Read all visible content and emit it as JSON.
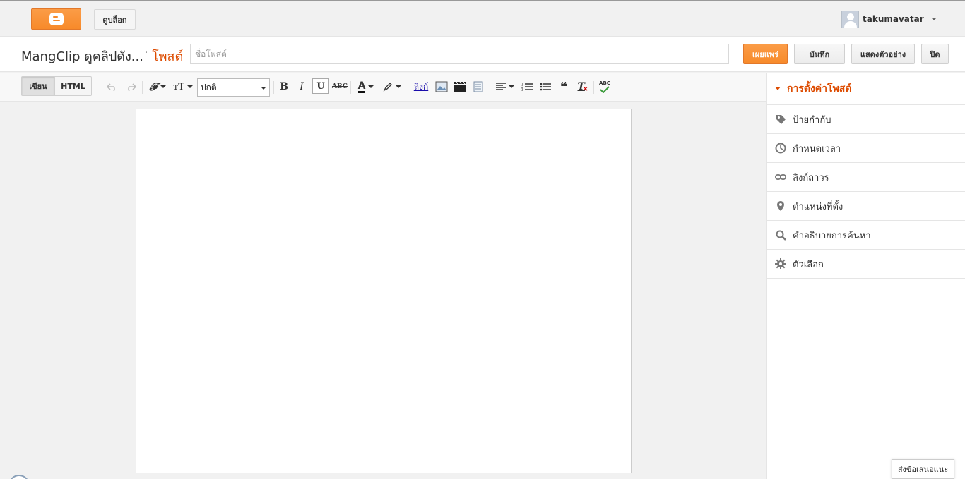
{
  "topbar": {
    "logo": "blogger-logo",
    "view_blog_label": "ดูบล็อก",
    "username": "takumavatar"
  },
  "titlebar": {
    "blog_name": "MangClip ดูคลิปดัง...",
    "separator": "·",
    "post_label": "โพสต์",
    "title_placeholder": "ชื่อโพสต์",
    "title_value": "",
    "publish_label": "เผยแพร่",
    "save_label": "บันทึก",
    "preview_label": "แสดงตัวอย่าง",
    "close_label": "ปิด"
  },
  "toolbar": {
    "mode_write": "เขียน",
    "mode_html": "HTML",
    "font_size_value": "ปกติ",
    "link_label": "ลิงก์",
    "spell_label": "ABC"
  },
  "sidebar": {
    "title": "การตั้งค่าโพสต์",
    "items": [
      {
        "label": "ป้ายกำกับ",
        "icon": "tag-icon"
      },
      {
        "label": "กำหนดเวลา",
        "icon": "clock-icon"
      },
      {
        "label": "ลิงก์ถาวร",
        "icon": "link-icon"
      },
      {
        "label": "ตำแหน่งที่ตั้ง",
        "icon": "location-pin-icon"
      },
      {
        "label": "คำอธิบายการค้นหา",
        "icon": "search-icon"
      },
      {
        "label": "ตัวเลือก",
        "icon": "gear-icon"
      }
    ]
  },
  "feedback_label": "ส่งข้อเสนอแนะ",
  "colors": {
    "accent": "#f78a2a",
    "accent_text": "#dd4b00"
  }
}
